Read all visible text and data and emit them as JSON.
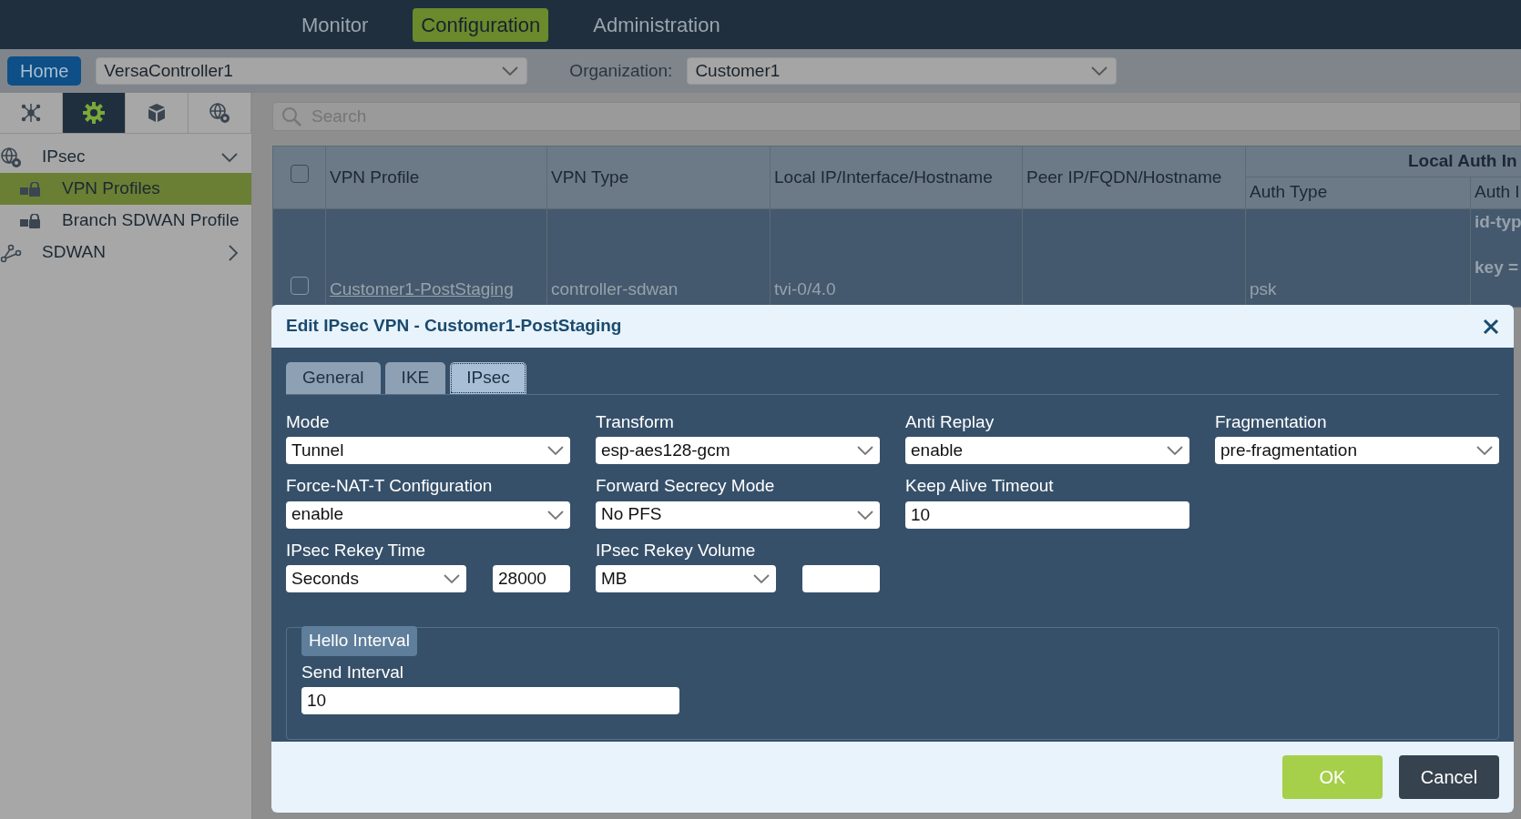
{
  "nav": {
    "items": [
      {
        "label": "Monitor",
        "selected": false
      },
      {
        "label": "Configuration",
        "selected": true
      },
      {
        "label": "Administration",
        "selected": false
      }
    ]
  },
  "toolbar": {
    "home": "Home",
    "appliance": "VersaController1",
    "organization_label": "Organization:",
    "organization": "Customer1"
  },
  "sidebar": {
    "tabs": [
      {
        "kind": "network",
        "selected": false
      },
      {
        "kind": "gear",
        "selected": true
      },
      {
        "kind": "cube",
        "selected": false
      },
      {
        "kind": "globe",
        "selected": false
      }
    ],
    "items": [
      {
        "label": "IPsec",
        "kind": "globe",
        "expanded": true,
        "children": [
          {
            "label": "VPN Profiles",
            "selected": true
          },
          {
            "label": "Branch SDWAN Profile",
            "selected": false
          }
        ]
      },
      {
        "label": "SDWAN",
        "kind": "branch",
        "expanded": false
      }
    ]
  },
  "search": {
    "placeholder": "Search"
  },
  "table": {
    "select_all_checked": false,
    "columns": [
      "VPN Profile",
      "VPN Type",
      "Local IP/Interface/Hostname",
      "Peer IP/FQDN/Hostname"
    ],
    "group": {
      "label": "Local Auth In",
      "columns": [
        "Auth Type",
        "Auth I"
      ]
    },
    "rows": [
      {
        "checked": false,
        "profile": "Customer1-PostStaging",
        "vpn_type": "controller-sdwan",
        "local": "tvi-0/4.0",
        "auth_type": "psk",
        "auth_lines": [
          "id-typ",
          "key ="
        ]
      }
    ]
  },
  "dialog": {
    "title": "Edit IPsec VPN - Customer1-PostStaging",
    "tabs": [
      {
        "label": "General",
        "selected": false
      },
      {
        "label": "IKE",
        "selected": false
      },
      {
        "label": "IPsec",
        "selected": true
      }
    ],
    "fields": [
      {
        "kind": "select",
        "label": "Mode",
        "value": "Tunnel"
      },
      {
        "kind": "select",
        "label": "Transform",
        "value": "esp-aes128-gcm"
      },
      {
        "kind": "select",
        "label": "Anti Replay",
        "value": "enable"
      },
      {
        "kind": "select",
        "label": "Fragmentation",
        "value": "pre-fragmentation"
      },
      {
        "kind": "select",
        "label": "Force-NAT-T Configuration",
        "value": "enable"
      },
      {
        "kind": "select",
        "label": "Forward Secrecy Mode",
        "value": "No PFS"
      },
      {
        "kind": "text",
        "label": "Keep Alive Timeout",
        "value": "10"
      },
      {
        "kind": "blank"
      },
      {
        "kind": "select-input",
        "label": "IPsec Rekey Time",
        "value": "Seconds",
        "amount": "28000"
      },
      {
        "kind": "select-input",
        "label": "IPsec Rekey Volume",
        "value": "MB"
      }
    ],
    "hello": {
      "legend": "Hello Interval",
      "label": "Send Interval",
      "value": "10"
    },
    "buttons": [
      {
        "label": "OK",
        "kind": "primary"
      },
      {
        "label": "Cancel",
        "kind": "secondary"
      }
    ]
  }
}
